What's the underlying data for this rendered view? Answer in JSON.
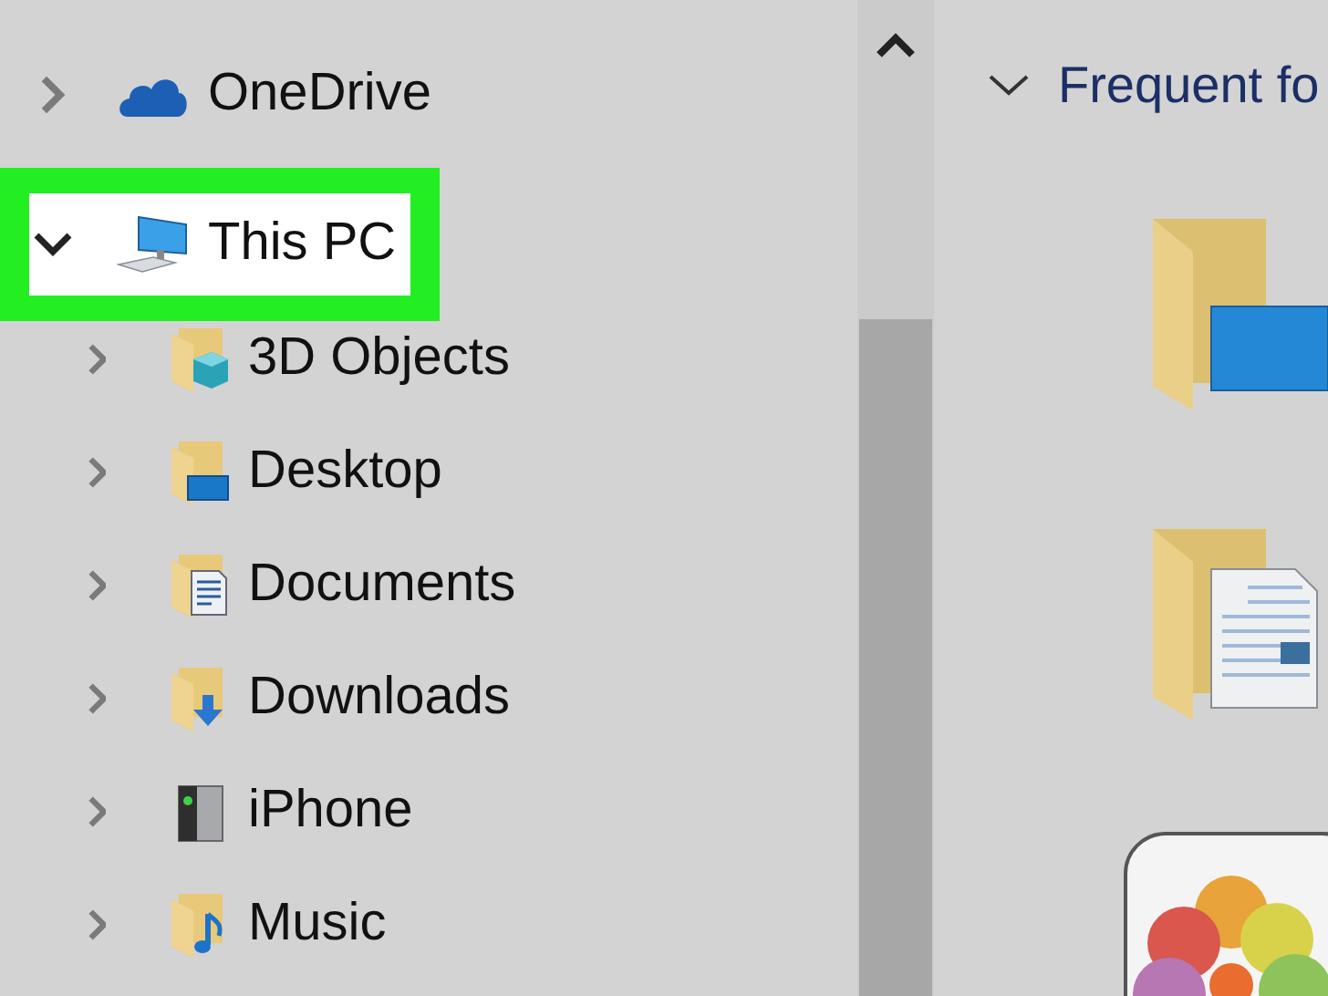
{
  "navigation_tree": [
    {
      "label": "OneDrive",
      "kind": "cloud",
      "expanded": false,
      "selected": false,
      "highlighted": false
    },
    {
      "label": "This PC",
      "kind": "pc",
      "expanded": true,
      "selected": true,
      "highlighted": true,
      "children": [
        {
          "label": "3D Objects",
          "kind": "folder-3d",
          "expanded": false,
          "selected": false,
          "highlighted": false
        },
        {
          "label": "Desktop",
          "kind": "folder-desktop",
          "expanded": false,
          "selected": false,
          "highlighted": false
        },
        {
          "label": "Documents",
          "kind": "folder-documents",
          "expanded": false,
          "selected": false,
          "highlighted": false
        },
        {
          "label": "Downloads",
          "kind": "folder-downloads",
          "expanded": false,
          "selected": false,
          "highlighted": false
        },
        {
          "label": "iPhone",
          "kind": "drive",
          "expanded": false,
          "selected": false,
          "highlighted": false
        },
        {
          "label": "Music",
          "kind": "folder-music",
          "expanded": false,
          "selected": false,
          "highlighted": false
        }
      ]
    }
  ],
  "frequent_folders": {
    "title": "Frequent fo",
    "expanded": true,
    "items": [
      {
        "kind": "folder-desktop"
      },
      {
        "kind": "folder-documents"
      },
      {
        "kind": "photos-app"
      }
    ]
  }
}
